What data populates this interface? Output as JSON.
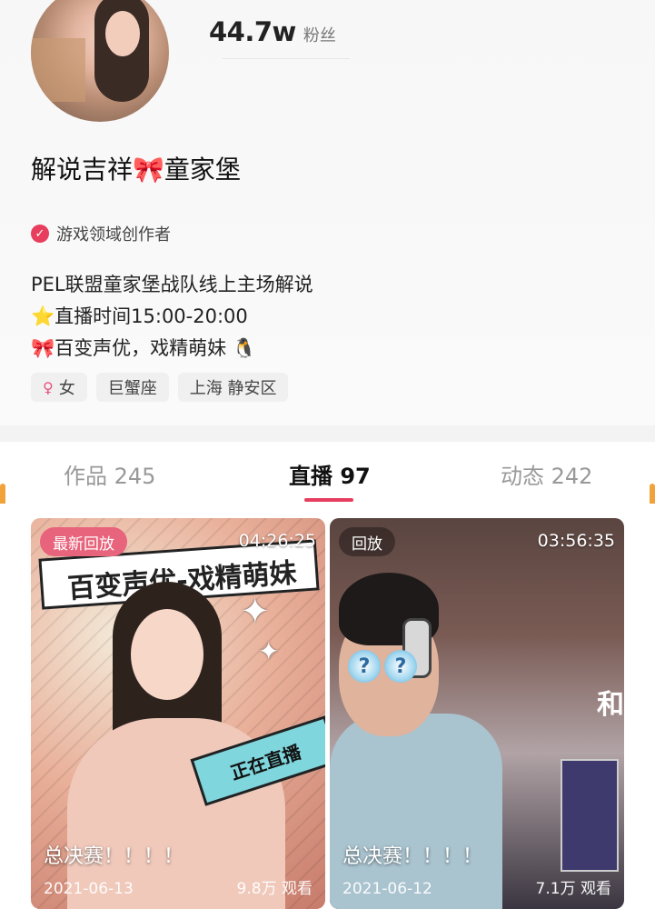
{
  "profile": {
    "fans_count": "44.7w",
    "fans_label": "粉丝",
    "name": "解说吉祥🎀童家堡",
    "verify_label": "游戏领域创作者",
    "bio": [
      "PEL联盟童家堡战队线上主场解说",
      "⭐直播时间15:00-20:00",
      "🎀百变声优，戏精萌妹 🐧"
    ],
    "tags": {
      "gender_icon": "♀",
      "gender": "女",
      "zodiac": "巨蟹座",
      "location": "上海 静安区"
    }
  },
  "tabs": [
    {
      "label": "作品 245",
      "active": false
    },
    {
      "label": "直播 97",
      "active": true
    },
    {
      "label": "动态 242",
      "active": false
    }
  ],
  "videos": [
    {
      "badge": "最新回放",
      "duration": "04:26:25",
      "title": "总决赛！！！！",
      "date": "2021-06-13",
      "views": "9.8万 观看",
      "sticker": "正在直播",
      "banner": "百变声优-戏精萌妹"
    },
    {
      "badge": "回放",
      "duration": "03:56:35",
      "title": "总决赛！！！！",
      "date": "2021-06-12",
      "views": "7.1万 观看",
      "wall_text": "和"
    }
  ],
  "colors": {
    "accent": "#e83e5e",
    "edge": "#f2a23b"
  }
}
